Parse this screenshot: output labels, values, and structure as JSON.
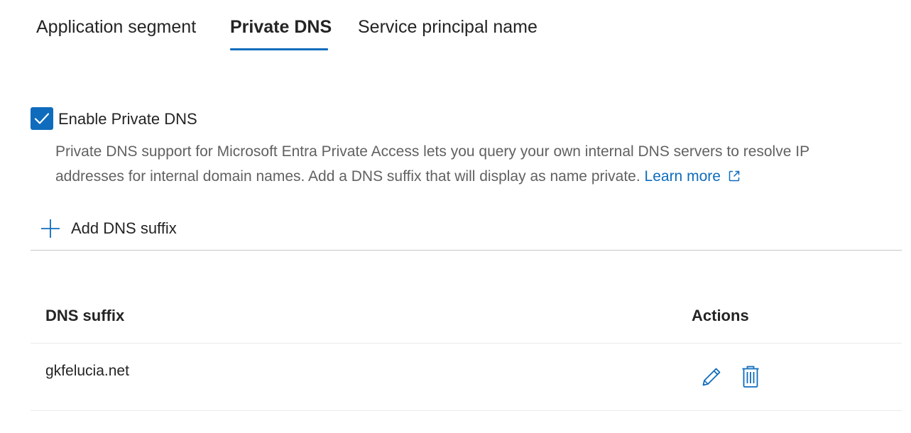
{
  "tabs": [
    {
      "label": "Application segment",
      "active": false
    },
    {
      "label": "Private DNS",
      "active": true
    },
    {
      "label": "Service principal name",
      "active": false
    }
  ],
  "private_dns": {
    "checkbox_label": "Enable Private DNS",
    "checked": true,
    "description": "Private DNS support for Microsoft Entra Private Access lets you query your own internal DNS servers to resolve IP addresses for internal domain names. Add a DNS suffix that will display as name private.",
    "learn_more": "Learn more",
    "learn_more_icon": "open-in-new-icon"
  },
  "add_button": {
    "label": "Add DNS suffix",
    "icon": "plus-icon"
  },
  "table": {
    "columns": [
      "DNS suffix",
      "Actions"
    ],
    "rows": [
      {
        "dns_suffix": "gkfelucia.net",
        "actions": [
          "edit-icon",
          "delete-icon"
        ]
      }
    ]
  },
  "colors": {
    "accent": "#0f6cbd",
    "text": "#242424",
    "secondary_text": "#616161"
  }
}
